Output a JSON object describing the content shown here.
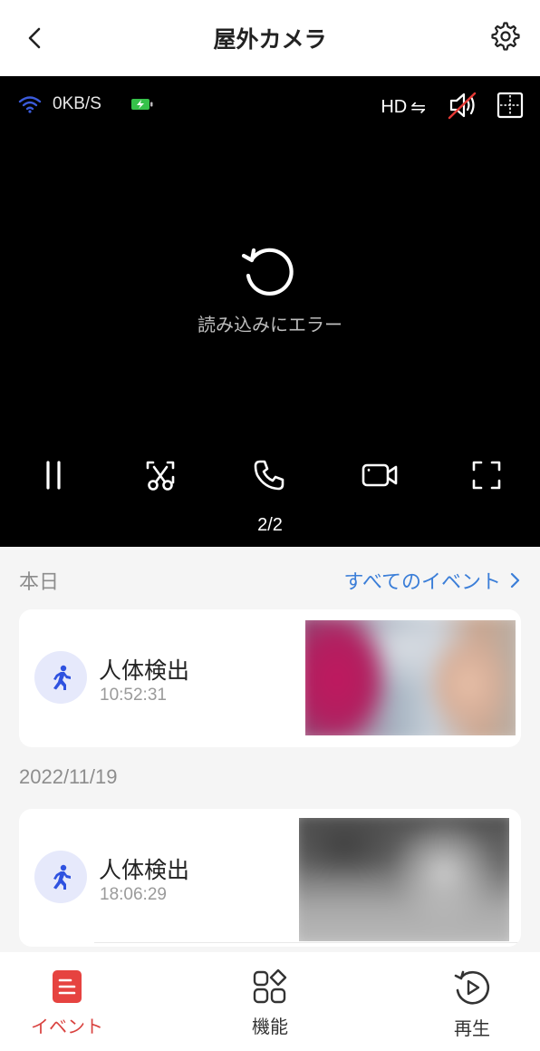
{
  "header": {
    "title": "屋外カメラ"
  },
  "video": {
    "network_speed": "0KB/S",
    "quality_label": "HD",
    "quality_toggle_glyph": "⇋",
    "error_text": "読み込みにエラー",
    "page_indicator": "2/2",
    "icons": [
      "wifi-icon",
      "battery-charging-icon",
      "speaker-muted-icon",
      "grid-icon",
      "reload-icon",
      "pause-icon",
      "screenshot-icon",
      "phone-icon",
      "record-video-icon",
      "fullscreen-icon"
    ]
  },
  "events": {
    "today_label": "本日",
    "all_events_link": "すべてのイベント",
    "groups": [
      {
        "date": "本日",
        "items": [
          {
            "title": "人体検出",
            "time": "10:52:31"
          }
        ]
      },
      {
        "date": "2022/11/19",
        "items": [
          {
            "title": "人体検出",
            "time": "18:06:29"
          }
        ]
      }
    ]
  },
  "bottom_nav": {
    "items": [
      {
        "label": "イベント",
        "active": true
      },
      {
        "label": "機能",
        "active": false
      },
      {
        "label": "再生",
        "active": false
      }
    ]
  },
  "colors": {
    "accent_blue": "#3b7ed8",
    "active_red": "#d9423f",
    "event_icon_blue": "#2f52e0"
  }
}
